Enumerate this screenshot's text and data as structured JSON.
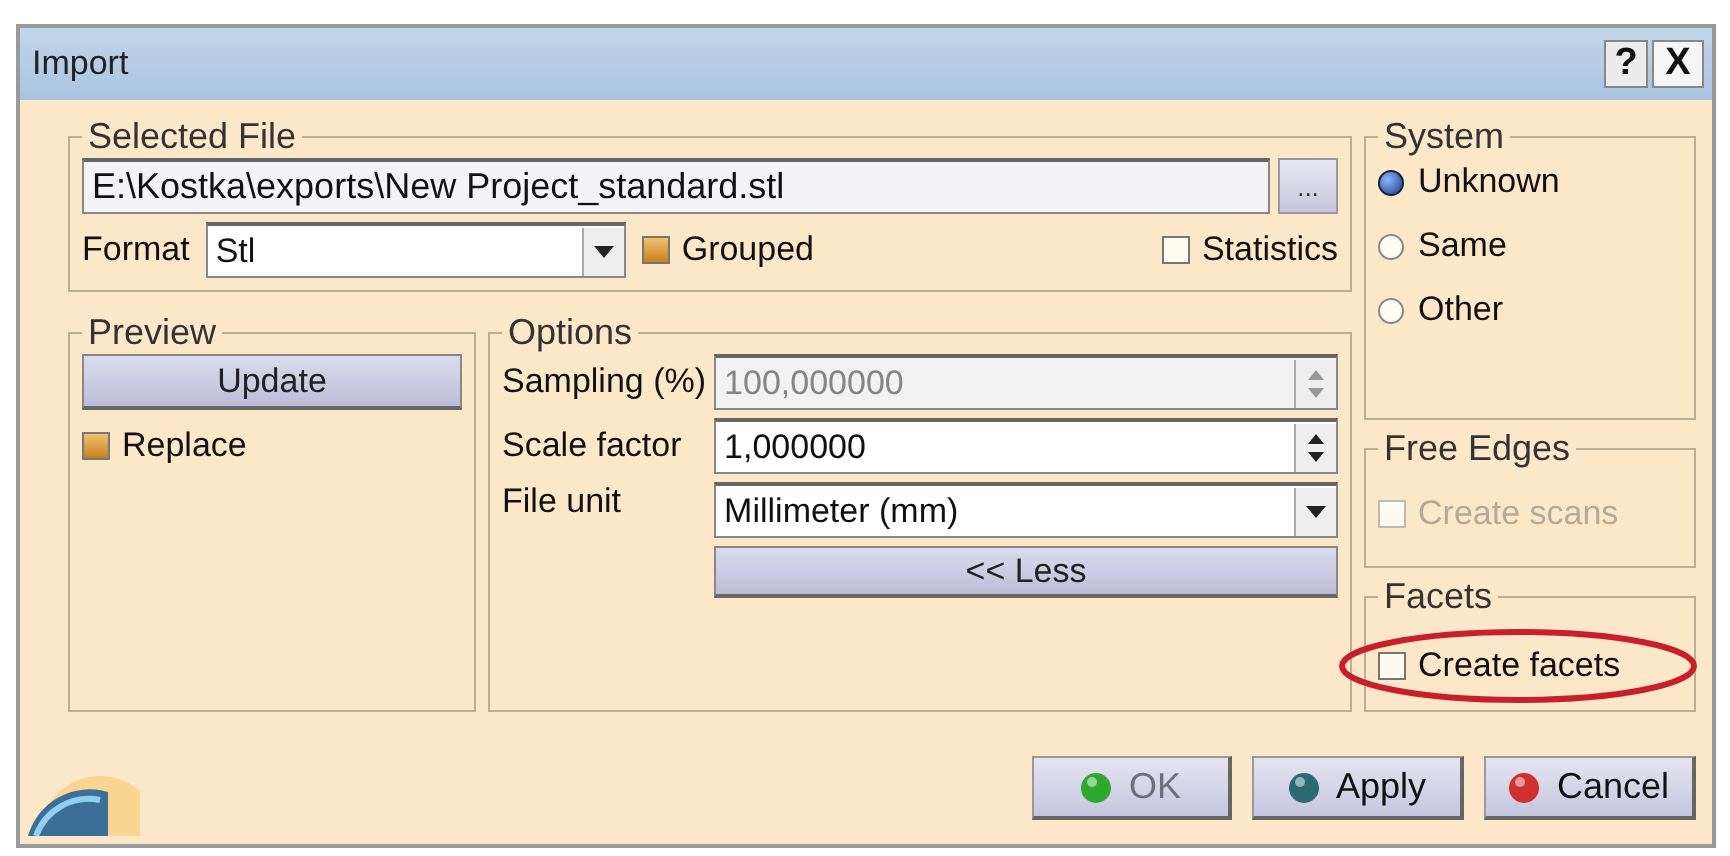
{
  "window": {
    "title": "Import",
    "buttons": [
      {
        "kind": "help",
        "label": "?"
      },
      {
        "kind": "close",
        "label": "X"
      }
    ]
  },
  "selected_file": {
    "title": "Selected File",
    "path": "E:\\Kostka\\exports\\New Project_standard.stl",
    "browse": "...",
    "format_label": "Format",
    "format": "Stl",
    "grouped": {
      "label": "Grouped",
      "checked": true
    },
    "statistics": {
      "label": "Statistics",
      "checked": false
    }
  },
  "preview": {
    "title": "Preview",
    "update": "Update",
    "replace": {
      "label": "Replace",
      "checked": true
    }
  },
  "options": {
    "title": "Options",
    "fields": [
      {
        "kind": "spin",
        "label": "Sampling (%)",
        "value": "100,000000",
        "disabled": true
      },
      {
        "kind": "spin",
        "label": "Scale factor",
        "value": "1,000000",
        "disabled": false
      },
      {
        "kind": "dropdown",
        "label": "File unit",
        "value": "Millimeter (mm)",
        "disabled": false
      }
    ],
    "less": "<< Less"
  },
  "system": {
    "title": "System",
    "options": [
      {
        "label": "Unknown",
        "selected": true
      },
      {
        "label": "Same",
        "selected": false
      },
      {
        "label": "Other",
        "selected": false
      }
    ]
  },
  "free_edges": {
    "title": "Free Edges",
    "create_scans": {
      "label": "Create scans",
      "checked": false,
      "disabled": true
    }
  },
  "facets": {
    "title": "Facets",
    "highlighted": true,
    "create_facets": {
      "label": "Create facets",
      "checked": false,
      "disabled": false
    }
  },
  "buttons": [
    {
      "label": "OK",
      "color": "#2fa82f",
      "disabled": true
    },
    {
      "label": "Apply",
      "color": "#2a6a70",
      "disabled": false
    },
    {
      "label": "Cancel",
      "color": "#d03030",
      "disabled": false
    }
  ]
}
